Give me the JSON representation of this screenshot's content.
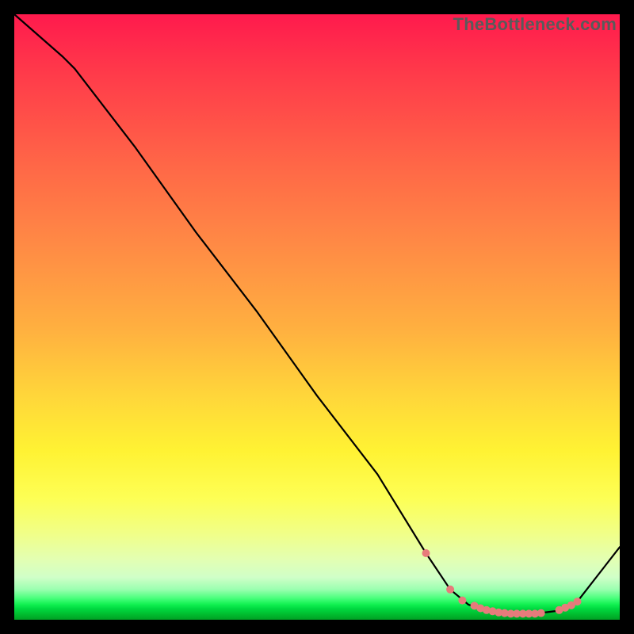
{
  "watermark": "TheBottleneck.com",
  "colors": {
    "gradient_top": "#ff1a4d",
    "gradient_mid1": "#ff8a45",
    "gradient_mid2": "#fff233",
    "gradient_bottom": "#00a024",
    "curve": "#000000",
    "markers": "#e77b7b",
    "background": "#000000"
  },
  "chart_data": {
    "type": "line",
    "title": "",
    "xlabel": "",
    "ylabel": "",
    "xlim": [
      0,
      100
    ],
    "ylim": [
      0,
      100
    ],
    "x": [
      0,
      8,
      10,
      20,
      30,
      40,
      50,
      60,
      68,
      72,
      75,
      78,
      82,
      86,
      90,
      93,
      100
    ],
    "y": [
      100,
      93,
      91,
      78,
      64,
      51,
      37,
      24,
      11,
      5,
      2.5,
      1.5,
      1.0,
      1.0,
      1.5,
      3,
      12
    ],
    "series": [
      {
        "name": "bottleneck-curve",
        "x": [
          0,
          8,
          10,
          20,
          30,
          40,
          50,
          60,
          68,
          72,
          75,
          78,
          82,
          86,
          90,
          93,
          100
        ],
        "y": [
          100,
          93,
          91,
          78,
          64,
          51,
          37,
          24,
          11,
          5,
          2.5,
          1.5,
          1.0,
          1.0,
          1.5,
          3,
          12
        ]
      }
    ],
    "markers": {
      "name": "optimal-zone-points",
      "x": [
        68,
        72,
        74,
        76,
        77,
        78,
        79,
        80,
        81,
        82,
        83,
        84,
        85,
        86,
        87,
        90,
        91,
        92,
        93
      ],
      "y": [
        11,
        5,
        3.2,
        2.3,
        1.9,
        1.6,
        1.4,
        1.2,
        1.1,
        1.0,
        1.0,
        1.0,
        1.0,
        1.0,
        1.1,
        1.6,
        2.0,
        2.4,
        3.0
      ]
    }
  }
}
